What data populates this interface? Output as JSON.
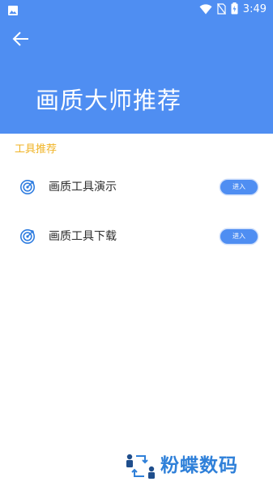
{
  "status_bar": {
    "time": "3:49",
    "icons": [
      "image-icon",
      "wifi-icon",
      "no-sim-icon",
      "battery-icon"
    ]
  },
  "header": {
    "back_icon": "arrow-left-icon",
    "title": "画质大师推荐"
  },
  "section": {
    "title": "工具推荐"
  },
  "items": [
    {
      "icon": "target-icon",
      "label": "画质工具演示",
      "button_label": "进入"
    },
    {
      "icon": "target-icon",
      "label": "画质工具下载",
      "button_label": "进入"
    }
  ],
  "watermark": {
    "text": "粉蝶数码"
  },
  "colors": {
    "primary": "#4f8ef2",
    "section_title": "#f0b325",
    "text": "#2c2c2c",
    "watermark": "#2f80d9"
  }
}
